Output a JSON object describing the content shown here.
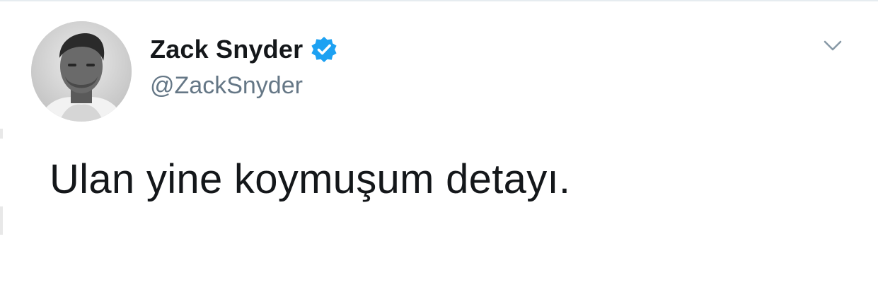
{
  "tweet": {
    "author": {
      "display_name": "Zack Snyder",
      "handle": "@ZackSnyder",
      "verified": true,
      "avatar_icon": "profile-photo"
    },
    "text": "Ulan yine koymuşum detayı.",
    "menu_icon": "chevron-down-icon"
  },
  "colors": {
    "verified_badge": "#1da1f2",
    "name_text": "#14171a",
    "handle_text": "#657786",
    "caret": "#8899a6"
  }
}
